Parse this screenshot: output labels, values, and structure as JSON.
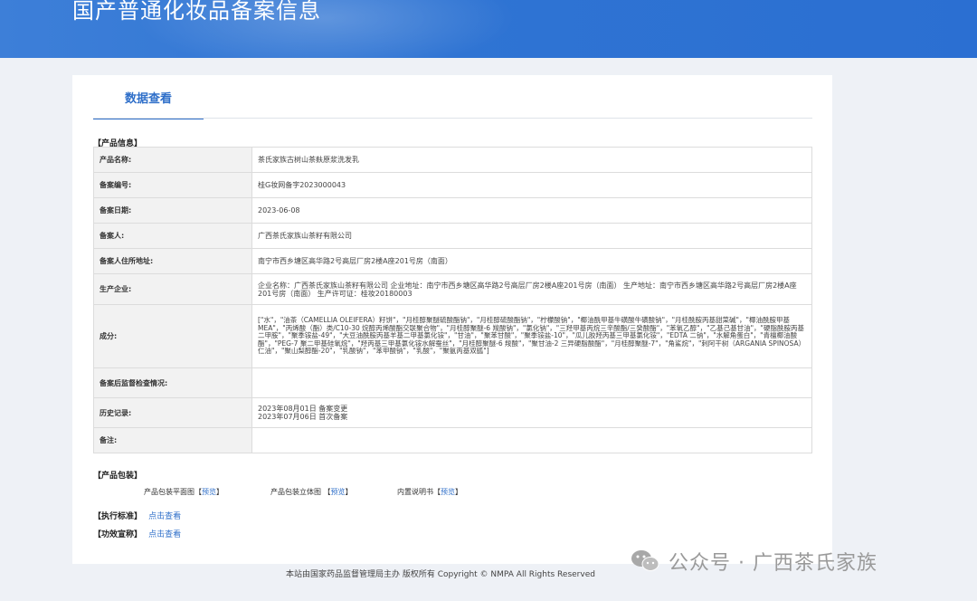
{
  "header": {
    "title": "国产普通化妆品备案信息"
  },
  "tab": {
    "label": "数据查看"
  },
  "sections": {
    "product_info": "【产品信息】",
    "packaging": "【产品包装】",
    "standard": "【执行标准】",
    "efficacy": "【功效宣称】"
  },
  "product": {
    "rows": [
      {
        "label": "产品名称:",
        "value": "茶氏家族古树山茶麸原浆洗发乳"
      },
      {
        "label": "备案编号:",
        "value": "桂G妆网备字2023000043"
      },
      {
        "label": "备案日期:",
        "value": "2023-06-08"
      },
      {
        "label": "备案人:",
        "value": "广西茶氏家族山茶籽有限公司"
      },
      {
        "label": "备案人住所地址:",
        "value": "南宁市西乡塘区高华路2号高层厂房2楼A座201号房（南面）"
      },
      {
        "label": "生产企业:",
        "value": "企业名称：广西茶氏家族山茶籽有限公司 企业地址：南宁市西乡塘区高华路2号高层厂房2楼A座201号房（南面） 生产地址：南宁市西乡塘区高华路2号高层厂房2楼A座201号房（南面） 生产许可证：桂妆20180003"
      },
      {
        "label": "成分:",
        "value": "[\"水\"，\"油茶（CAMELLIA OLEIFERA）籽饼\"，\"月桂醇聚醚硫酸酯钠\"，\"月桂醇硫酸酯钠\"，\"柠檬酸钠\"，\"椰油酰甲基牛磺酸牛磺酸钠\"，\"月桂酰胺丙基甜菜碱\"，\"椰油酰胺甲基 MEA\"，\"丙烯酸（酯）类/C10-30 烷醇丙烯酸酯交联聚合物\"，\"月桂醇聚醚-6 羧酸钠\"，\"氯化钠\"，\"三羟甲基丙烷三辛酸酯/三癸酸酯\"，\"苯氧乙醇\"，\"乙基己基甘油\"，\"硬脂酰胺丙基二甲胺\"，\"聚季铵盐-49\"，\"大豆油酰胺丙基羊基二甲基氯化铵\"，\"甘油\"，\"聚苯甘酸\"，\"聚季铵盐-10\"，\"瓜儿胶羟丙基三甲基氯化铵\"，\"EDTA 二钠\"，\"水解角蛋白\"，\"青檀椰油酸酯\"，\"PEG-7 聚二甲基硅氧烷\"，\"羟丙基三甲基氯化铵水解蚕丝\"，\"月桂醇聚醚-6 羧酸\"，\"聚甘油-2 三异硬脂酸酯\"，\"月桂醇聚醚-7\"，\"角鲨烷\"，\"刺阿干树（ARGANIA SPINOSA）仁油\"，\"聚山梨醇酯-20\"，\"乳酸钠\"，\"苯甲酸钠\"，\"乳酸\"，\"聚氨丙基双胍\"]"
      },
      {
        "label": "备案后监督检查情况:",
        "value": ""
      },
      {
        "label": "历史记录:",
        "value": "2023年08月01日 备案变更\n2023年07月06日 首次备案"
      },
      {
        "label": "备注:",
        "value": ""
      }
    ]
  },
  "packaging": {
    "items": [
      {
        "label": "产品包装平面图",
        "link": "预览"
      },
      {
        "label": "产品包装立体图",
        "link": "预览"
      },
      {
        "label": "内置说明书",
        "link": "预览"
      }
    ]
  },
  "standard": {
    "link": "点击查看"
  },
  "efficacy": {
    "link": "点击查看"
  },
  "footer": {
    "text": "本站由国家药品监督管理局主办 版权所有 Copyright © NMPA All Rights Reserved"
  },
  "watermark": {
    "text": "公众号 · 广西茶氏家族",
    "icon": "wechat-icon"
  }
}
